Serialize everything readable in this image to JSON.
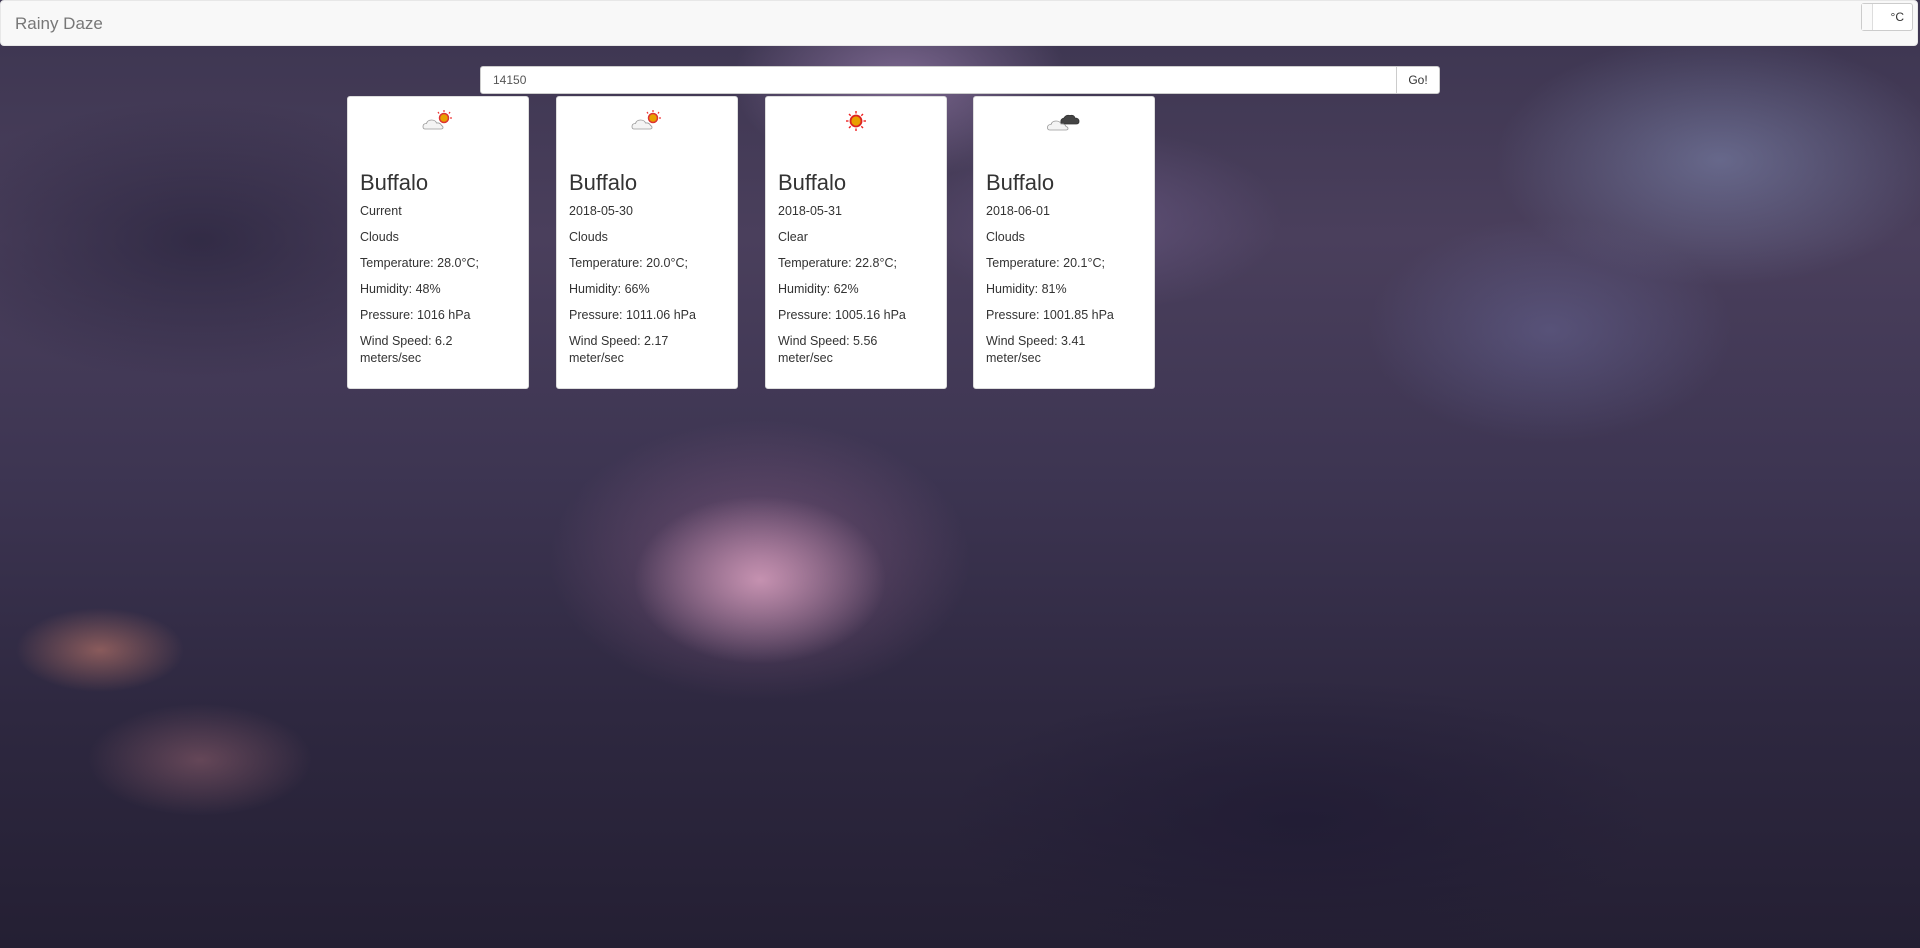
{
  "navbar": {
    "brand": "Rainy Daze",
    "unit_label": "°C"
  },
  "search": {
    "value": "14150",
    "button_label": "Go!"
  },
  "forecast": [
    {
      "icon": "partly-cloudy-sun-icon",
      "city": "Buffalo",
      "date": "Current",
      "condition": "Clouds",
      "temperature": "Temperature: 28.0°C;",
      "humidity": "Humidity: 48%",
      "pressure": "Pressure: 1016 hPa",
      "wind": "Wind Speed: 6.2 meters/sec"
    },
    {
      "icon": "partly-cloudy-sun-icon",
      "city": "Buffalo",
      "date": "2018-05-30",
      "condition": "Clouds",
      "temperature": "Temperature: 20.0°C;",
      "humidity": "Humidity: 66%",
      "pressure": "Pressure: 1011.06 hPa",
      "wind": "Wind Speed: 2.17 meter/sec"
    },
    {
      "icon": "sun-icon",
      "city": "Buffalo",
      "date": "2018-05-31",
      "condition": "Clear",
      "temperature": "Temperature: 22.8°C;",
      "humidity": "Humidity: 62%",
      "pressure": "Pressure: 1005.16 hPa",
      "wind": "Wind Speed: 5.56 meter/sec"
    },
    {
      "icon": "overcast-clouds-icon",
      "city": "Buffalo",
      "date": "2018-06-01",
      "condition": "Clouds",
      "temperature": "Temperature: 20.1°C;",
      "humidity": "Humidity: 81%",
      "pressure": "Pressure: 1001.85 hPa",
      "wind": "Wind Speed: 3.41 meter/sec"
    }
  ]
}
